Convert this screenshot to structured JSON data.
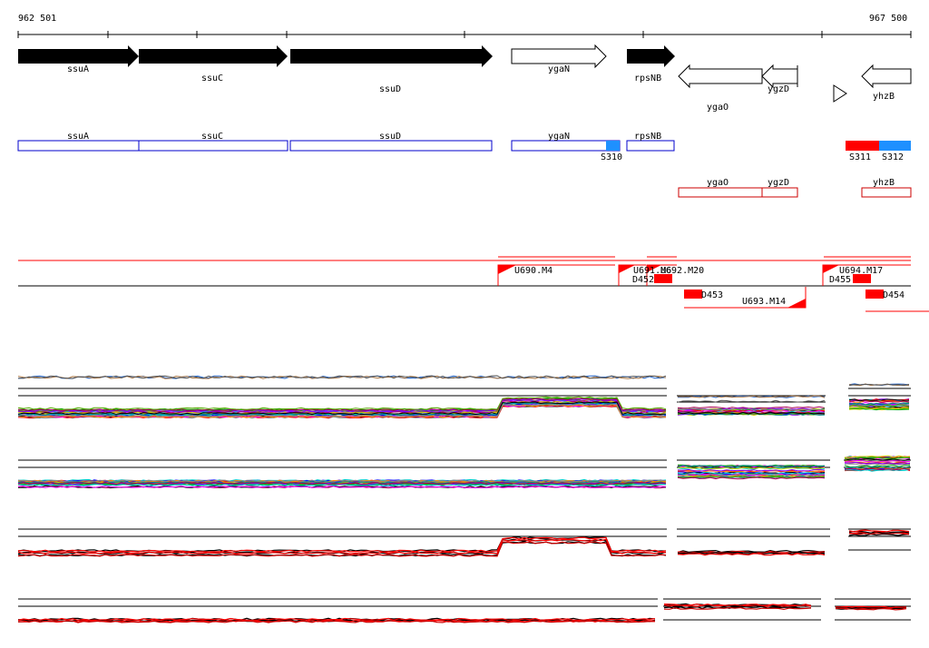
{
  "ruler": {
    "start_label": "962 501",
    "end_label": "967 500"
  },
  "genes": [
    {
      "name": "ssuA",
      "strand": "+",
      "style": "filled"
    },
    {
      "name": "ssuC",
      "strand": "+",
      "style": "filled"
    },
    {
      "name": "ssuD",
      "strand": "+",
      "style": "filled"
    },
    {
      "name": "ygaN",
      "strand": "+",
      "style": "outline"
    },
    {
      "name": "rpsNB",
      "strand": "+",
      "style": "filled"
    },
    {
      "name": "ygaO",
      "strand": "-",
      "style": "outline"
    },
    {
      "name": "ygzD",
      "strand": "-",
      "style": "outline"
    },
    {
      "name": "",
      "strand": "+",
      "style": "triangle"
    },
    {
      "name": "yhzB",
      "strand": "-",
      "style": "outline"
    }
  ],
  "plus_annotations": [
    {
      "name": "ssuA"
    },
    {
      "name": "ssuC"
    },
    {
      "name": "ssuD"
    },
    {
      "name": "ygaN"
    },
    {
      "name": "rpsNB"
    }
  ],
  "plus_signals": [
    {
      "name": "S310",
      "color": "#1e90ff"
    },
    {
      "name": "S311",
      "color": "#ff0000"
    },
    {
      "name": "S312",
      "color": "#1e90ff"
    }
  ],
  "minus_annotations": [
    {
      "name": "ygaO"
    },
    {
      "name": "ygzD"
    },
    {
      "name": "yhzB"
    }
  ],
  "upshifts": [
    {
      "name": "U690.M4"
    },
    {
      "name": "U691.M6"
    },
    {
      "name": "U692.M20"
    },
    {
      "name": "U694.M17"
    },
    {
      "name": "U693.M14"
    }
  ],
  "downshifts": [
    {
      "name": "D452"
    },
    {
      "name": "D455"
    },
    {
      "name": "D453"
    },
    {
      "name": "D454"
    }
  ],
  "colors": {
    "gene_fill": "#000000",
    "plus_box": "#0000cc",
    "minus_box": "#cc0000",
    "segment": "#ff0000",
    "signal_blue": "#1e90ff",
    "signal_red": "#ff0000"
  }
}
